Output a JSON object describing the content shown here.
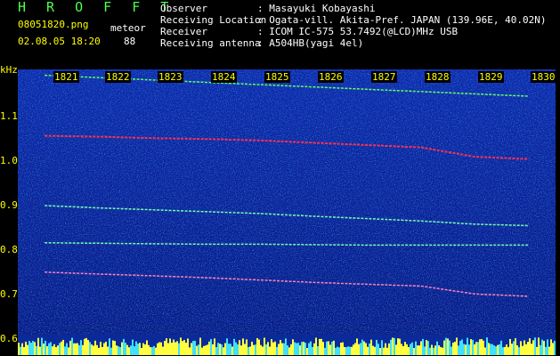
{
  "app": {
    "logo": "H R O F F T"
  },
  "file": {
    "name": "08051820.png",
    "datetime": "02.08.05 18:20"
  },
  "meteor": {
    "label": "meteor",
    "count": "88"
  },
  "info": [
    {
      "key": "Observer",
      "value": ": Masayuki Kobayashi"
    },
    {
      "key": "Receiving Location",
      "value": ": Ogata-vill. Akita-Pref. JAPAN (139.96E, 40.02N)"
    },
    {
      "key": "Receiver",
      "value": ": ICOM IC-575 53.7492(@LCD)MHz USB"
    },
    {
      "key": "Receiving antenna",
      "value": ": A504HB(yagi 4el)"
    }
  ],
  "axis": {
    "y_unit": "kHz",
    "y_ticks": [
      "1.1",
      "1.0",
      "0.9",
      "0.8",
      "0.7",
      "0.6"
    ],
    "x_ticks": [
      "1821",
      "1822",
      "1823",
      "1824",
      "1825",
      "1826",
      "1827",
      "1828",
      "1829",
      "1830"
    ]
  },
  "colors": {
    "background": "#000000",
    "spectrum_base": "#0a1f8a",
    "logo": "#4cff4c",
    "labels": "#ffff00",
    "text": "#ffffff"
  },
  "chart_data": {
    "type": "heatmap",
    "x": [
      "1821",
      "1822",
      "1823",
      "1824",
      "1825",
      "1826",
      "1827",
      "1828",
      "1829",
      "1830"
    ],
    "y_range": [
      0.6,
      1.17
    ],
    "lines": [
      {
        "values": [
          1.165,
          1.16,
          1.155,
          1.15,
          1.145,
          1.14,
          1.135,
          1.13,
          1.125,
          1.12
        ]
      },
      {
        "values": [
          1.035,
          1.033,
          1.03,
          1.028,
          1.025,
          1.02,
          1.015,
          1.01,
          0.99,
          0.985
        ]
      },
      {
        "values": [
          0.885,
          0.88,
          0.876,
          0.872,
          0.868,
          0.862,
          0.857,
          0.852,
          0.845,
          0.842
        ]
      },
      {
        "values": [
          0.805,
          0.804,
          0.803,
          0.802,
          0.802,
          0.801,
          0.8,
          0.8,
          0.8,
          0.8
        ]
      },
      {
        "values": [
          0.742,
          0.738,
          0.734,
          0.73,
          0.725,
          0.72,
          0.716,
          0.712,
          0.695,
          0.69
        ]
      }
    ]
  }
}
